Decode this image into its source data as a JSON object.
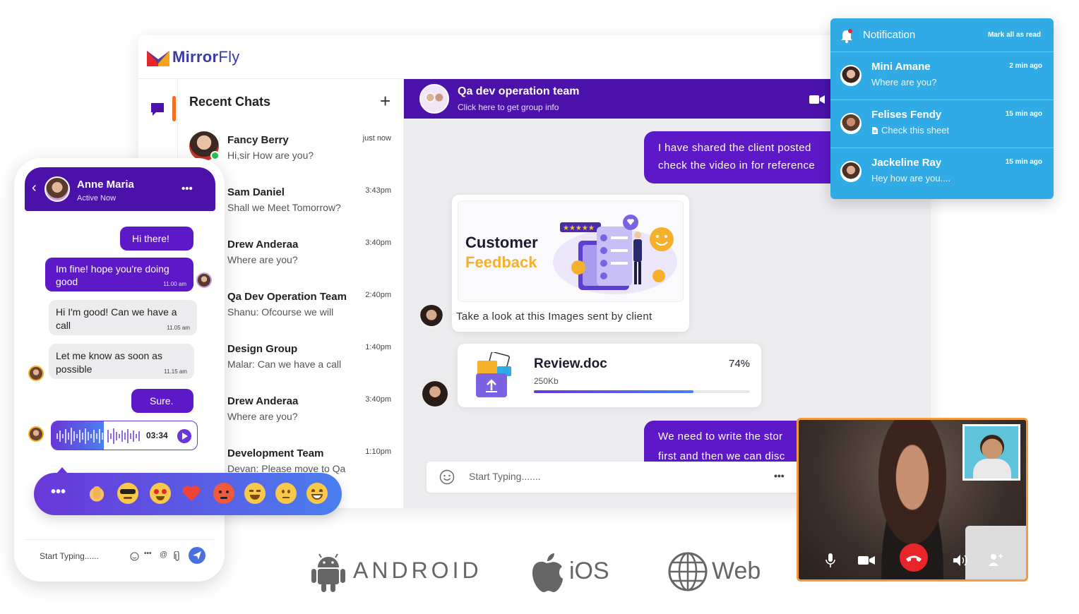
{
  "brand": {
    "name_first": "Mirror",
    "name_second": "Fly"
  },
  "recent_chats": {
    "title": "Recent Chats",
    "add_label": "+",
    "items": [
      {
        "name": "Fancy Berry",
        "message": "Hi,sir How are you?",
        "time": "just now"
      },
      {
        "name": "Sam Daniel",
        "message": "Shall we Meet Tomorrow?",
        "time": "3:43pm"
      },
      {
        "name": "Drew Anderaa",
        "message": "Where are you?",
        "time": "3:40pm"
      },
      {
        "name": "Qa Dev Operation Team",
        "message": "Shanu: Ofcourse we will",
        "time": "2:40pm"
      },
      {
        "name": "Design Group",
        "message": "Malar: Can we have a call",
        "time": "1:40pm"
      },
      {
        "name": "Drew Anderaa",
        "message": "Where are you?",
        "time": "3:40pm"
      },
      {
        "name": "Development Team",
        "message": "Devan: Please move to Qa",
        "time": "1:10pm"
      }
    ]
  },
  "conversation": {
    "title": "Qa dev operation team",
    "subtitle": "Click here to get group info",
    "msg_shared_1": "I have shared the client posted",
    "msg_shared_2": "check the video in for reference",
    "feedback_title_1": "Customer",
    "feedback_title_2": "Feedback",
    "image_caption": "Take a look at this Images sent by client",
    "file_name": "Review.doc",
    "file_size": "250Kb",
    "file_progress_label": "74%",
    "file_progress": 0.74,
    "msg_story_1": "We need to write the stor",
    "msg_story_2": "first and then we can disc",
    "input_placeholder": "Start Typing.......",
    "more_label": "•••"
  },
  "notifications": {
    "title": "Notification",
    "mark_all": "Mark all as read",
    "items": [
      {
        "name": "Mini Amane",
        "message": "Where are you?",
        "time": "2 min ago"
      },
      {
        "name": "Felises Fendy",
        "message": "Check this sheet",
        "time": "15 min ago"
      },
      {
        "name": "Jackeline Ray",
        "message": "Hey how are you....",
        "time": "15 min ago"
      }
    ]
  },
  "phone": {
    "contact_name": "Anne Maria",
    "contact_status": "Active Now",
    "menu_label": "•••",
    "msg_hi": "Hi there!",
    "msg_fine": "Im fine! hope you're doing good",
    "msg_fine_time": "11.00 am",
    "msg_good": "Hi I'm good! Can we have a call",
    "msg_good_time": "11.05 am",
    "msg_letme": "Let me know as soon as possible",
    "msg_letme_time": "11.15 am",
    "msg_sure": "Sure.",
    "voice_duration": "03:34",
    "input_placeholder": "Start Typing......",
    "more_label": "•••",
    "at_label": "@"
  },
  "emoji_bar": {
    "more_label": "•••"
  },
  "platforms": {
    "android": "ANDROID",
    "ios": "iOS",
    "web": "Web"
  },
  "colors": {
    "primary_purple": "#4a12a8",
    "bubble_purple": "#5d18c8",
    "notification_blue": "#31abe5",
    "accent_orange": "#f36f21",
    "end_call_red": "#e8262a"
  }
}
